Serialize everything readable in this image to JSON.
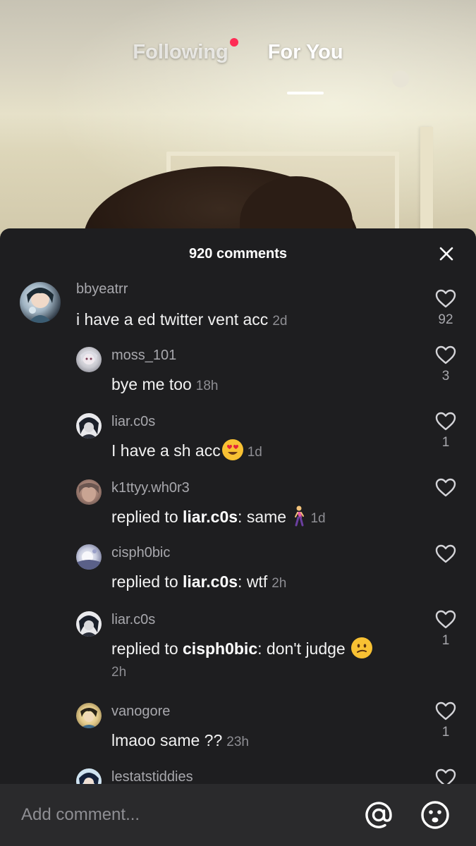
{
  "top_tabs": {
    "following": "Following",
    "for_you": "For You"
  },
  "comments_sheet": {
    "title": "920 comments"
  },
  "comments": [
    {
      "username": "bbyeatrr",
      "text": "i have a ed twitter vent acc",
      "time": "2d",
      "likes": "92"
    },
    {
      "username": "moss_101",
      "text": "bye me too",
      "time": "18h",
      "likes": "3"
    },
    {
      "username": "liar.c0s",
      "text": "I have a sh acc",
      "emoji": "heart-eyes-emoji",
      "time": "1d",
      "likes": "1"
    },
    {
      "username": "k1ttyy.wh0r3",
      "reply_prefix": "replied to ",
      "mention": "liar.c0s",
      "text": ": same",
      "emoji": "walking-person-emoji",
      "time": "1d",
      "likes": ""
    },
    {
      "username": "cisph0bic",
      "reply_prefix": "replied to ",
      "mention": "liar.c0s",
      "text": ": wtf",
      "time": "2h",
      "likes": ""
    },
    {
      "username": "liar.c0s",
      "reply_prefix": "replied to ",
      "mention": "cisph0bic",
      "text": ": don't judge",
      "emoji": "confused-face-emoji",
      "time": "2h",
      "likes": "1"
    },
    {
      "username": "vanogore",
      "text": "lmaoo same ??",
      "time": "23h",
      "likes": "1"
    },
    {
      "username": "lestatstiddies"
    }
  ],
  "input": {
    "placeholder": "Add comment..."
  },
  "colors": {
    "sheet_bg": "#1e1e20",
    "input_bg": "#2a2a2c",
    "notification_dot": "#fe2c55",
    "secondary_text": "#a8a8ad"
  },
  "icons": [
    "close-icon",
    "heart-outline-icon",
    "at-sign-icon",
    "emoji-icon"
  ]
}
